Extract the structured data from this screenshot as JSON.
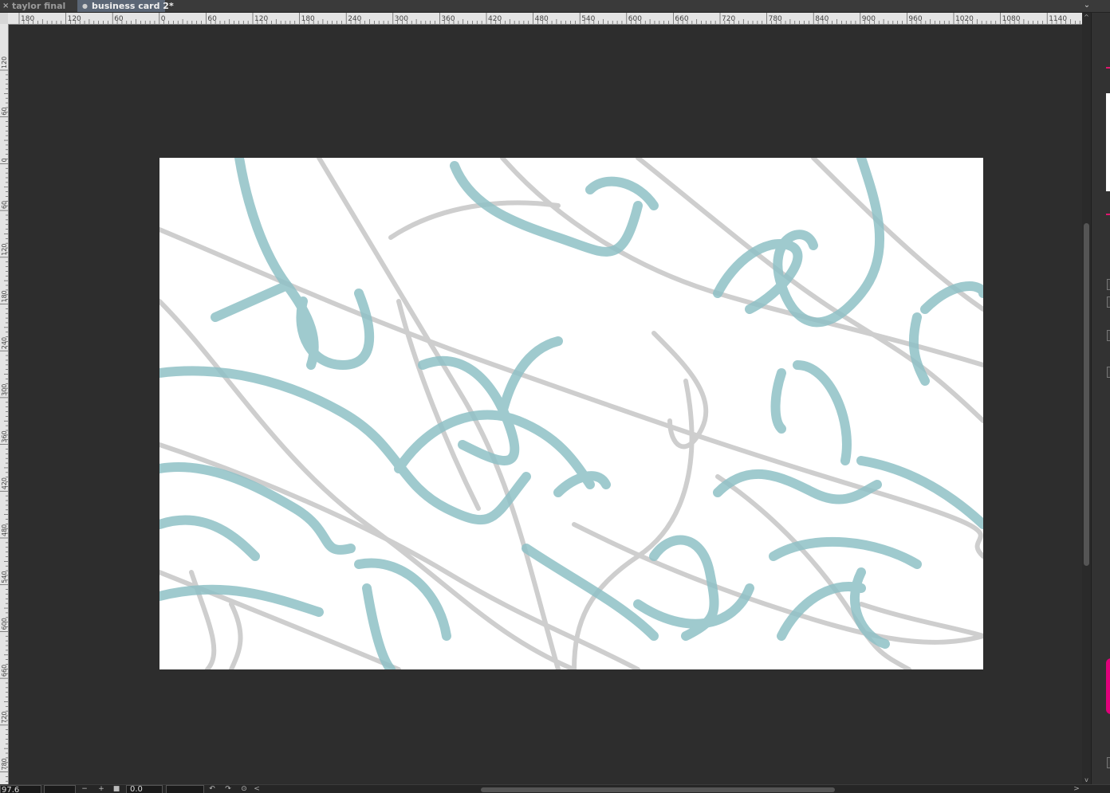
{
  "tabs": [
    {
      "label": "taylor final",
      "close_icon": "×",
      "active": false
    },
    {
      "label": "business card 2*",
      "modified_icon": "●",
      "active": true
    }
  ],
  "tab_menu_icon": "⌄",
  "ruler": {
    "h_labels": [
      "180",
      "120",
      "60",
      "0",
      "60",
      "120",
      "180",
      "240",
      "300",
      "360",
      "420",
      "480",
      "540",
      "600",
      "660",
      "720",
      "780",
      "840",
      "900",
      "960",
      "1020",
      "1080",
      "1140"
    ],
    "v_labels": [
      "120",
      "60",
      "0",
      "60",
      "120",
      "180",
      "240",
      "300",
      "360",
      "420",
      "480",
      "540",
      "600",
      "660",
      "720",
      "780"
    ]
  },
  "colors": {
    "teal_stroke": "#8fc1c6",
    "gray_stroke": "#c9c9c9",
    "canvas_bg": "#2d2d2d",
    "artboard": "#ffffff",
    "accent_magenta": "#e0166e"
  },
  "statusbar": {
    "zoom_value": "97.6",
    "zoom_out_icon": "−",
    "zoom_in_icon": "+",
    "fit_icon": "■",
    "rotation_value": "0.0",
    "rotate_ccw_icon": "↶",
    "rotate_cw_icon": "↷",
    "reset_rotation_icon": "⊙",
    "scroll_left_icon": "<",
    "scroll_right_icon": ">"
  },
  "scrollbar": {
    "up_icon": "^",
    "down_icon": "v"
  }
}
